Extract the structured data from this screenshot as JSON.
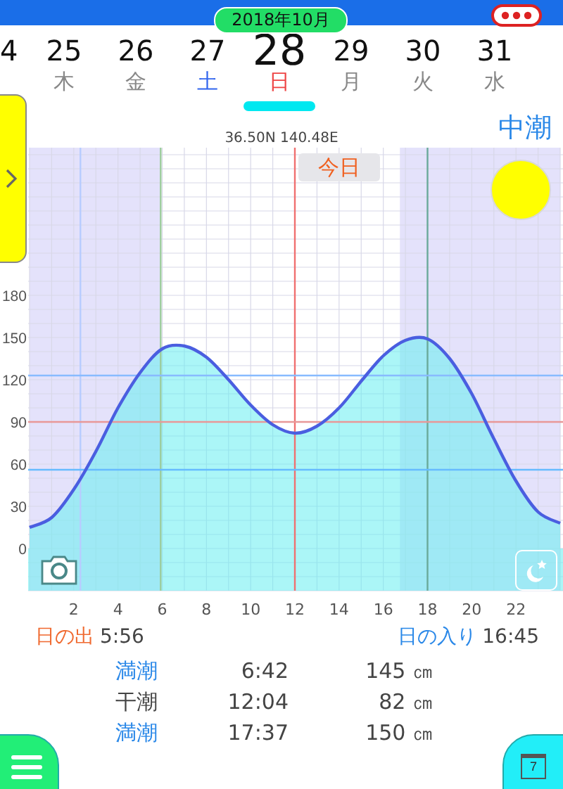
{
  "header": {
    "month": "2018年10月"
  },
  "days": [
    {
      "day": "4",
      "selected": false
    },
    {
      "day": "25",
      "weekday": "木",
      "selected": false,
      "color": "#888888"
    },
    {
      "day": "26",
      "weekday": "金",
      "selected": false,
      "color": "#888888"
    },
    {
      "day": "27",
      "weekday": "土",
      "selected": false,
      "color": "#3366ee"
    },
    {
      "day": "28",
      "weekday": "日",
      "selected": true,
      "color": "#ee4444"
    },
    {
      "day": "29",
      "weekday": "月",
      "selected": false,
      "color": "#888888"
    },
    {
      "day": "30",
      "weekday": "火",
      "selected": false,
      "color": "#888888"
    },
    {
      "day": "31",
      "weekday": "水",
      "selected": false,
      "color": "#888888"
    }
  ],
  "tide_name": "中潮",
  "coordinates": "36.50N 140.48E",
  "today_label": "今日",
  "chart": {
    "chart_data": {
      "type": "area",
      "grid": true,
      "xlim": [
        0,
        24
      ],
      "ylim": [
        -30,
        285
      ],
      "bands": [
        {
          "axis": "x",
          "from": 0,
          "to": 5.93,
          "color": "#e4e2fb"
        },
        {
          "axis": "x",
          "from": 16.75,
          "to": 24,
          "color": "#e4e2fb"
        },
        {
          "axis": "y",
          "from": -30,
          "to": 0,
          "color": "#66eef0"
        }
      ],
      "ref_lines": [
        {
          "axis": "x",
          "value": 2.3,
          "color": "#b8ccff"
        },
        {
          "axis": "x",
          "value": 5.93,
          "color": "#9ccc9c"
        },
        {
          "axis": "x",
          "value": 18,
          "color": "#6aaa9a"
        },
        {
          "axis": "x",
          "value": 12,
          "color": "#f07070"
        },
        {
          "axis": "y",
          "value": 123,
          "color": "#88bbff"
        },
        {
          "axis": "y",
          "value": 90,
          "color": "#e89898"
        },
        {
          "axis": "y",
          "value": 56,
          "color": "#66bbff"
        }
      ],
      "xticks": [
        2,
        4,
        6,
        8,
        10,
        12,
        14,
        16,
        18,
        20,
        22
      ],
      "yticks": [
        0,
        30,
        60,
        90,
        120,
        150,
        180
      ],
      "x": [
        0,
        1,
        2,
        3,
        4,
        5,
        6,
        7,
        8,
        9,
        10,
        11,
        12,
        13,
        14,
        15,
        16,
        17,
        18,
        19,
        20,
        21,
        22,
        23,
        24
      ],
      "series": [
        {
          "color": "#4a5ee0",
          "values": [
            15,
            22,
            42,
            69,
            100,
            125,
            142,
            144,
            136,
            120,
            102,
            88,
            82,
            87,
            100,
            119,
            137,
            148,
            149,
            135,
            110,
            78,
            48,
            26,
            18
          ]
        }
      ]
    }
  },
  "sun": {
    "rise_label": "日の出",
    "rise_time": "5:56",
    "set_label": "日の入り",
    "set_time": "16:45"
  },
  "tides": [
    {
      "kind": "high",
      "type": "満潮",
      "time": "6:42",
      "height": "145 ㎝"
    },
    {
      "kind": "low",
      "type": "干潮",
      "time": "12:04",
      "height": "82 ㎝"
    },
    {
      "kind": "high",
      "type": "満潮",
      "time": "17:37",
      "height": "150 ㎝"
    }
  ],
  "calendar_day": "7"
}
